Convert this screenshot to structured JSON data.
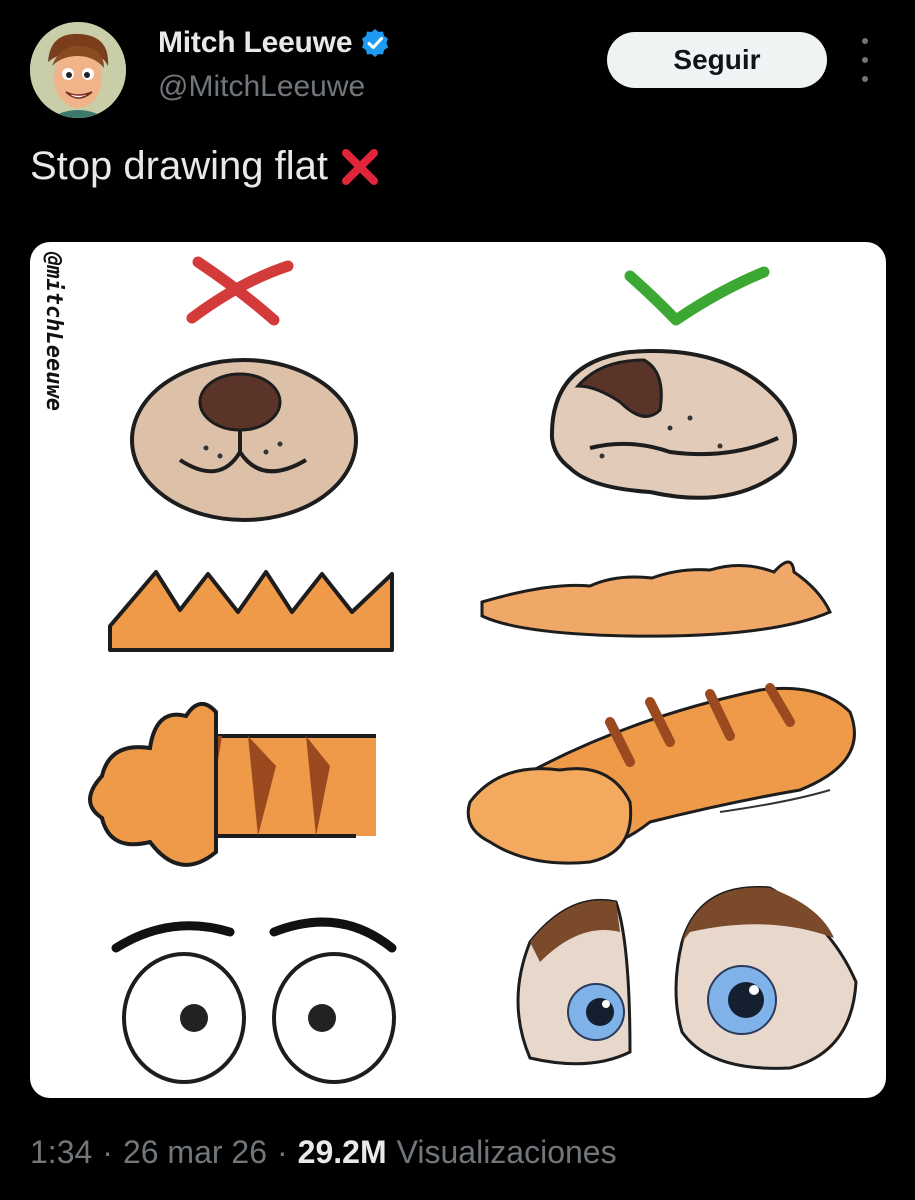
{
  "author": {
    "name": "Mitch Leeuwe",
    "handle": "@MitchLeeuwe",
    "verified": true
  },
  "follow_label": "Seguir",
  "tweet": {
    "text": "Stop drawing flat",
    "emoji": "cross-mark-icon"
  },
  "media": {
    "watermark": "@mitchLeeuwe",
    "left_column_marker": "red-cross-icon",
    "right_column_marker": "green-check-icon"
  },
  "footer": {
    "time": "1:34",
    "date": "26 mar 26",
    "views_count": "29.2M",
    "views_label": "Visualizaciones"
  },
  "colors": {
    "background": "#000000",
    "follow_button_bg": "#eff3f4",
    "verified_badge": "#1d9bf0",
    "muted_text": "#71767b",
    "cross_red": "#d33a3a",
    "check_green": "#3aa832"
  }
}
